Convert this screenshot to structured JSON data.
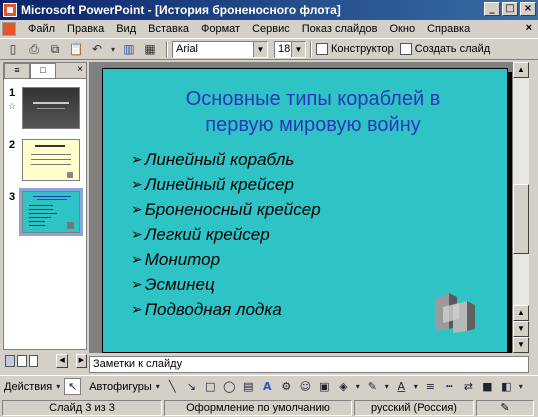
{
  "window": {
    "title": "Microsoft PowerPoint - [История броненосного флота]",
    "buttons": {
      "minimize": "_",
      "maximize": "□",
      "close": "×"
    }
  },
  "menu": {
    "items": [
      "Файл",
      "Правка",
      "Вид",
      "Вставка",
      "Формат",
      "Сервис",
      "Показ слайдов",
      "Окно",
      "Справка"
    ],
    "close": "×"
  },
  "toolbar": {
    "font_name": "Arial",
    "font_size": "18",
    "designer_label": "Конструктор",
    "new_slide_label": "Создать слайд"
  },
  "outline_pane": {
    "tabs": [
      "≡",
      "□"
    ],
    "close": "×",
    "slides": [
      {
        "number": "1"
      },
      {
        "number": "2"
      },
      {
        "number": "3"
      }
    ]
  },
  "slide": {
    "title_line1": "Основные типы кораблей в",
    "title_line2": "первую мировую войну",
    "bullet_marker": "➢",
    "bullets": [
      "Линейный корабль",
      "Линейный крейсер",
      "Броненосный крейсер",
      "Легкий крейсер",
      "Монитор",
      "Эсминец",
      "Подводная лодка"
    ]
  },
  "notes": {
    "placeholder": "Заметки к слайду"
  },
  "drawing_toolbar": {
    "actions_label": "Действия",
    "autoshapes_label": "Автофигуры"
  },
  "statusbar": {
    "slide_info": "Слайд 3 из 3",
    "design": "Оформление по умолчанию",
    "language": "русский (Россия)"
  },
  "colors": {
    "slide_background": "#2ec4c6",
    "title_text": "#2b36b8",
    "titlebar": "#0a246a"
  }
}
